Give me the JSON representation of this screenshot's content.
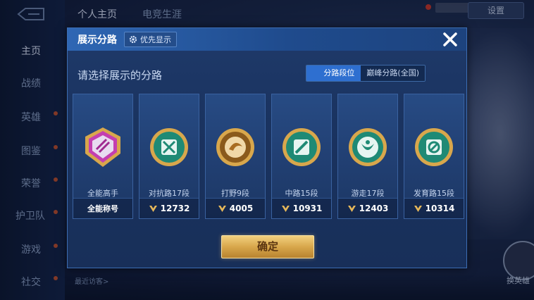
{
  "background": {
    "top_tabs": [
      "个人主页",
      "电竞生涯"
    ],
    "settings_label": "设置",
    "nav_items": [
      {
        "label": "主页",
        "active": true
      },
      {
        "label": "战绩"
      },
      {
        "label": "英雄"
      },
      {
        "label": "图鉴"
      },
      {
        "label": "荣誉"
      },
      {
        "label": "护卫队"
      },
      {
        "label": "游戏"
      },
      {
        "label": "社交"
      }
    ],
    "recent_visit_label": "最近访客>",
    "switch_hero_label": "换英雄"
  },
  "modal": {
    "title": "展示分路",
    "priority_label": "优先显示",
    "subtitle": "请选择展示的分路",
    "segments": [
      {
        "label": "分路段位",
        "active": true
      },
      {
        "label": "巅峰分路(全国)",
        "active": false
      }
    ],
    "cards": [
      {
        "name": "全能高手",
        "footer": "全能称号",
        "emblem": "allround-emblem-icon",
        "color": "#c43fb0"
      },
      {
        "name": "对抗路17段",
        "footer": "12732",
        "emblem": "clash-lane-emblem-icon",
        "color": "#23a88c"
      },
      {
        "name": "打野9段",
        "footer": "4005",
        "emblem": "jungle-emblem-icon",
        "color": "#c07a22"
      },
      {
        "name": "中路15段",
        "footer": "10931",
        "emblem": "mid-lane-emblem-icon",
        "color": "#23a88c"
      },
      {
        "name": "游走17段",
        "footer": "12403",
        "emblem": "roam-emblem-icon",
        "color": "#23a88c"
      },
      {
        "name": "发育路15段",
        "footer": "10314",
        "emblem": "farm-lane-emblem-icon",
        "color": "#23a88c"
      }
    ],
    "confirm_label": "确定"
  },
  "colors": {
    "accent": "#2e6fd0",
    "gold": "#d8a74c"
  }
}
